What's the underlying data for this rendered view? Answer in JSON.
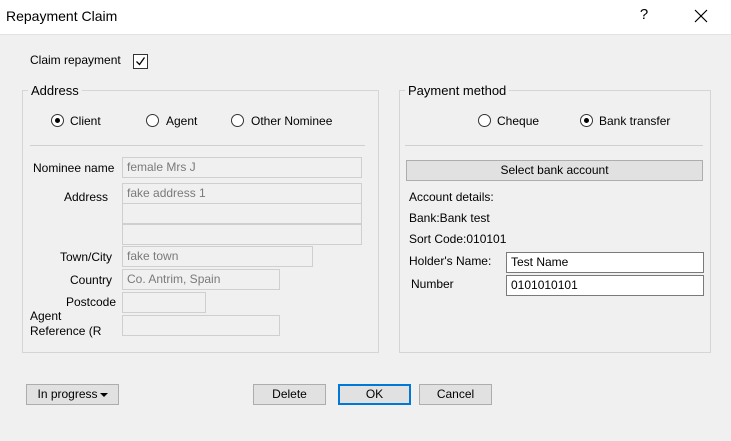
{
  "window": {
    "title": "Repayment Claim",
    "help": "?"
  },
  "claim": {
    "label": "Claim repayment",
    "checked": true
  },
  "address": {
    "group_title": "Address",
    "options": [
      {
        "label": "Client",
        "selected": true
      },
      {
        "label": "Agent",
        "selected": false
      },
      {
        "label": "Other Nominee",
        "selected": false
      }
    ],
    "nominee_label": "Nominee name",
    "nominee_value": "female  Mrs J",
    "address_label": "Address",
    "address_lines": [
      "fake address 1",
      "",
      ""
    ],
    "town_label": "Town/City",
    "town_value": "fake town",
    "country_label": "Country",
    "country_value": "Co. Antrim, Spain",
    "postcode_label": "Postcode",
    "postcode_value": "",
    "agent_ref_label_1": "Agent",
    "agent_ref_label_2": "Reference (R",
    "agent_ref_value": ""
  },
  "payment": {
    "group_title": "Payment method",
    "options": [
      {
        "label": "Cheque",
        "selected": false
      },
      {
        "label": "Bank transfer",
        "selected": true
      }
    ],
    "select_bank_label": "Select bank account",
    "account_details_label": "Account details:",
    "bank_line": "Bank:Bank test",
    "sort_code_line": "Sort Code:010101",
    "holder_label": "Holder's Name:",
    "holder_value": "Test Name",
    "number_label": "Number",
    "number_value": "0101010101"
  },
  "footer": {
    "status_label": "In progress",
    "delete_label": "Delete",
    "ok_label": "OK",
    "cancel_label": "Cancel"
  }
}
